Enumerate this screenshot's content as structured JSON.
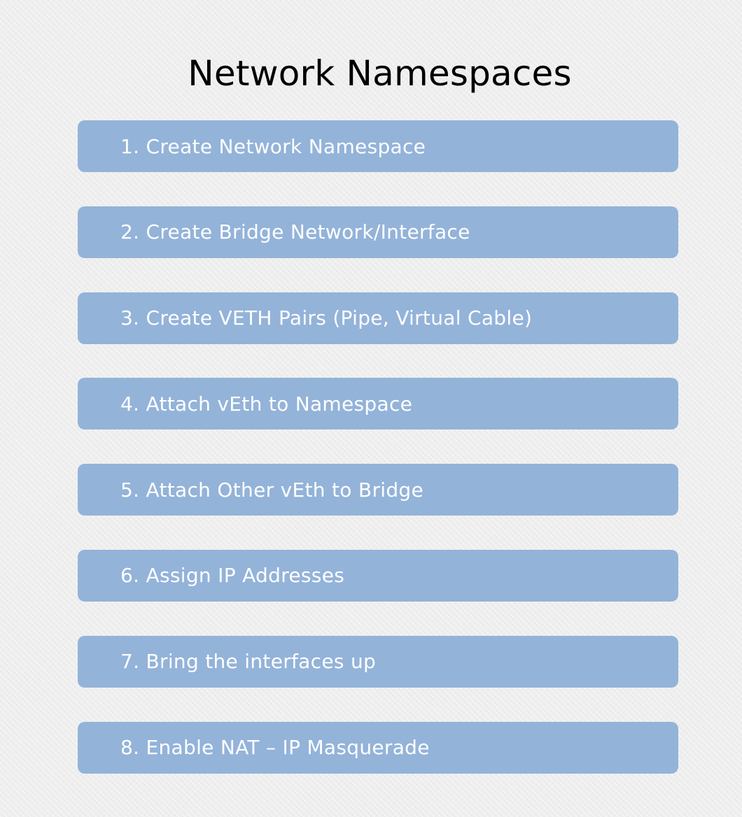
{
  "title": "Network Namespaces",
  "steps": [
    {
      "label": "1. Create Network Namespace"
    },
    {
      "label": "2. Create Bridge Network/Interface"
    },
    {
      "label": "3. Create VETH Pairs (Pipe, Virtual Cable)"
    },
    {
      "label": "4. Attach vEth to Namespace"
    },
    {
      "label": "5. Attach Other vEth to Bridge"
    },
    {
      "label": "6. Assign IP Addresses"
    },
    {
      "label": "7. Bring the interfaces up"
    },
    {
      "label": "8. Enable NAT – IP Masquerade"
    }
  ],
  "colors": {
    "step_fill": "#93b3d9",
    "step_text": "#ffffff",
    "title_text": "#000000",
    "background": "#eeeeee"
  }
}
